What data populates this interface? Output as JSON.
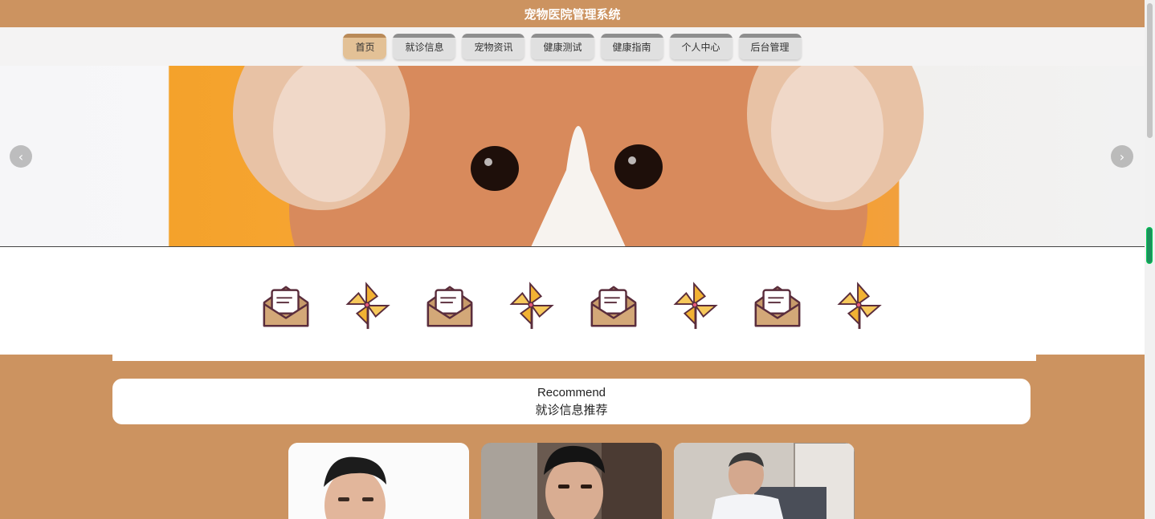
{
  "header": {
    "title": "宠物医院管理系统"
  },
  "nav": {
    "items": [
      {
        "label": "首页",
        "active": true
      },
      {
        "label": "就诊信息",
        "active": false
      },
      {
        "label": "宠物资讯",
        "active": false
      },
      {
        "label": "健康测试",
        "active": false
      },
      {
        "label": "健康指南",
        "active": false
      },
      {
        "label": "个人中心",
        "active": false
      },
      {
        "label": "后台管理",
        "active": false
      }
    ]
  },
  "banner": {
    "prev_icon": "chevron-left-icon",
    "next_icon": "chevron-right-icon"
  },
  "icons": [
    "envelope-icon",
    "pinwheel-icon",
    "envelope-icon",
    "pinwheel-icon",
    "envelope-icon",
    "pinwheel-icon",
    "envelope-icon",
    "pinwheel-icon"
  ],
  "recommend": {
    "title_en": "Recommend",
    "title_cn": "就诊信息推荐"
  },
  "colors": {
    "brand": "#cc9360",
    "nav_bg": "#f4f3f3",
    "active_tab": "#e3c196"
  }
}
